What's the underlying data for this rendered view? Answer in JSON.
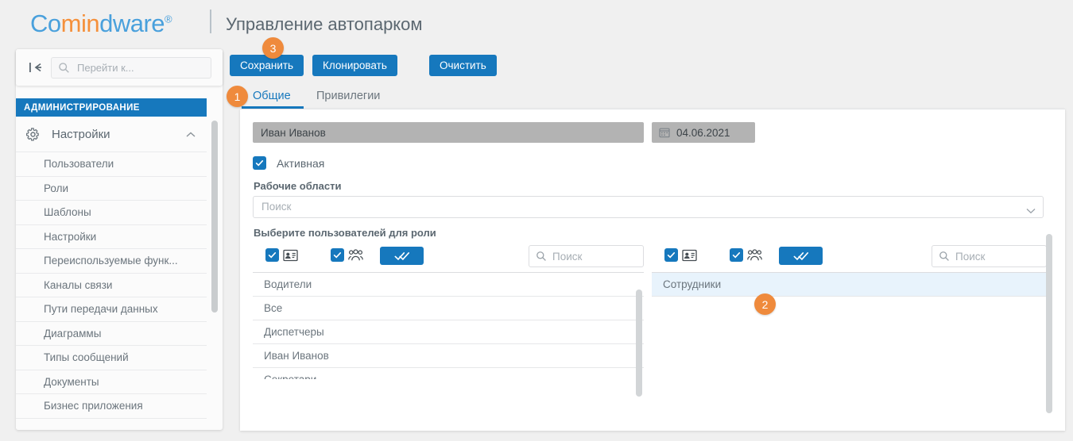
{
  "header": {
    "logo_part1": "Co",
    "logo_part2": "min",
    "logo_part3": "dware",
    "logo_reg": "®",
    "app_title": "Управление автопарком",
    "accent_blue": "#1678bd",
    "logo_blue": "#49a0dc",
    "logo_orange": "#f5903b",
    "badge_orange": "#ef8a3c"
  },
  "navbox": {
    "collapse_icon": "collapse-left-icon",
    "search_icon": "search-icon",
    "goto_value": "",
    "goto_placeholder": "Перейти к..."
  },
  "sidebar": {
    "section_title": "АДМИНИСТРИРОВАНИЕ",
    "group": {
      "label": "Настройки",
      "icon": "gear-icon",
      "chevron": "chevron-up-icon",
      "expanded": true
    },
    "items": [
      {
        "label": "Пользователи"
      },
      {
        "label": "Роли"
      },
      {
        "label": "Шаблоны"
      },
      {
        "label": "Настройки"
      },
      {
        "label": "Переиспользуемые функ..."
      },
      {
        "label": "Каналы связи"
      },
      {
        "label": "Пути передачи данных"
      },
      {
        "label": "Диаграммы"
      },
      {
        "label": "Типы сообщений"
      },
      {
        "label": "Документы"
      },
      {
        "label": "Бизнес приложения"
      }
    ]
  },
  "toolbar": {
    "save_label": "Сохранить",
    "clone_label": "Клонировать",
    "clear_label": "Очистить"
  },
  "tabs": [
    {
      "label": "Общие",
      "active": true
    },
    {
      "label": "Привилегии",
      "active": false
    }
  ],
  "form": {
    "name_value": "Иван Иванов",
    "name_placeholder": "",
    "date_value": "04.06.2021",
    "date_icon": "calendar-icon",
    "active_checkbox": {
      "label": "Активная",
      "checked": true,
      "icon": "check-icon"
    },
    "workspaces": {
      "label": "Рабочие области",
      "placeholder": "Поиск",
      "value": "",
      "chevron": "chevron-down-icon"
    },
    "picker_label": "Выберите пользователей для роли"
  },
  "picker_left": {
    "checkbox_card": {
      "icon": "contact-card-icon",
      "checked": true
    },
    "checkbox_group": {
      "icon": "user-group-icon",
      "checked": true
    },
    "select_all_button": {
      "icon": "double-check-icon"
    },
    "search_icon": "search-icon",
    "search_placeholder": "Поиск",
    "search_value": "",
    "items": [
      {
        "label": "Водители",
        "selected": false
      },
      {
        "label": "Все",
        "selected": false
      },
      {
        "label": "Диспетчеры",
        "selected": false
      },
      {
        "label": "Иван Иванов",
        "selected": false
      },
      {
        "label": "Секретари",
        "selected": false
      }
    ]
  },
  "picker_right": {
    "checkbox_card": {
      "icon": "contact-card-icon",
      "checked": true
    },
    "checkbox_group": {
      "icon": "user-group-icon",
      "checked": true
    },
    "select_all_button": {
      "icon": "double-check-icon"
    },
    "search_icon": "search-icon",
    "search_placeholder": "Поиск",
    "search_value": "",
    "items": [
      {
        "label": "Сотрудники",
        "selected": true
      }
    ]
  },
  "badges": [
    {
      "number": "1"
    },
    {
      "number": "2"
    },
    {
      "number": "3"
    }
  ]
}
